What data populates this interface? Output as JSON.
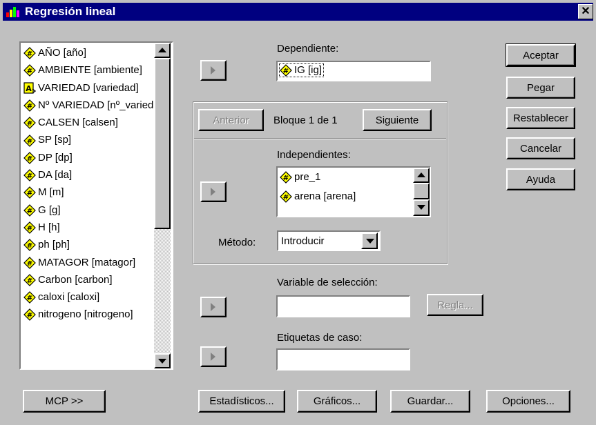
{
  "window": {
    "title": "Regresión lineal",
    "close_label": "✕"
  },
  "variables": [
    {
      "label": "AÑO [año]",
      "type": "numeric"
    },
    {
      "label": "AMBIENTE [ambiente]",
      "type": "numeric"
    },
    {
      "label": "VARIEDAD [variedad]",
      "type": "string"
    },
    {
      "label": "Nº VARIEDAD [nº_variedad]",
      "type": "numeric"
    },
    {
      "label": "CALSEN [calsen]",
      "type": "numeric"
    },
    {
      "label": "SP [sp]",
      "type": "numeric"
    },
    {
      "label": "DP [dp]",
      "type": "numeric"
    },
    {
      "label": "DA [da]",
      "type": "numeric"
    },
    {
      "label": "M [m]",
      "type": "numeric"
    },
    {
      "label": "G [g]",
      "type": "numeric"
    },
    {
      "label": "H [h]",
      "type": "numeric"
    },
    {
      "label": "ph [ph]",
      "type": "numeric"
    },
    {
      "label": "MATAGOR [matagor]",
      "type": "numeric"
    },
    {
      "label": "Carbon [carbon]",
      "type": "numeric"
    },
    {
      "label": "caloxi [caloxi]",
      "type": "numeric"
    },
    {
      "label": "nitrogeno [nitrogeno]",
      "type": "numeric"
    }
  ],
  "dependiente": {
    "label": "Dependiente:",
    "value": "IG [ig]"
  },
  "block": {
    "prev": "Anterior",
    "text": "Bloque 1 de 1",
    "next": "Siguiente"
  },
  "independientes": {
    "label": "Independientes:",
    "items": [
      "pre_1",
      "arena [arena]"
    ]
  },
  "metodo": {
    "label": "Método:",
    "value": "Introducir"
  },
  "seleccion": {
    "label": "Variable de selección:",
    "regla": "Regla..."
  },
  "etiquetas": {
    "label": "Etiquetas de caso:"
  },
  "side_buttons": [
    "Aceptar",
    "Pegar",
    "Restablecer",
    "Cancelar",
    "Ayuda"
  ],
  "bottom_buttons": {
    "mcp": "MCP >>",
    "estadisticos": "Estadísticos...",
    "graficos": "Gráficos...",
    "guardar": "Guardar...",
    "opciones": "Opciones..."
  },
  "icons": {
    "numeric": "numeric-variable-icon",
    "string": "string-variable-icon"
  }
}
